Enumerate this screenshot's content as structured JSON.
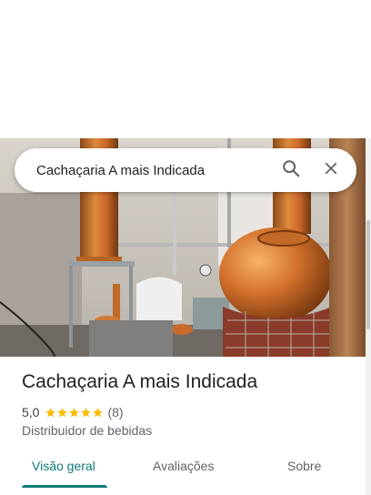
{
  "search": {
    "query": "Cachaçaria A mais Indicada"
  },
  "place": {
    "name": "Cachaçaria A mais Indicada",
    "rating": "5,0",
    "stars": 5,
    "review_count": "(8)",
    "category": "Distribuidor de bebidas"
  },
  "tabs": [
    {
      "label": "Visão geral",
      "active": true
    },
    {
      "label": "Avaliações",
      "active": false
    },
    {
      "label": "Sobre",
      "active": false
    }
  ],
  "colors": {
    "accent": "#0b7a75",
    "star": "#fbbc04",
    "text": "#202124",
    "secondary_text": "#5f6368"
  }
}
